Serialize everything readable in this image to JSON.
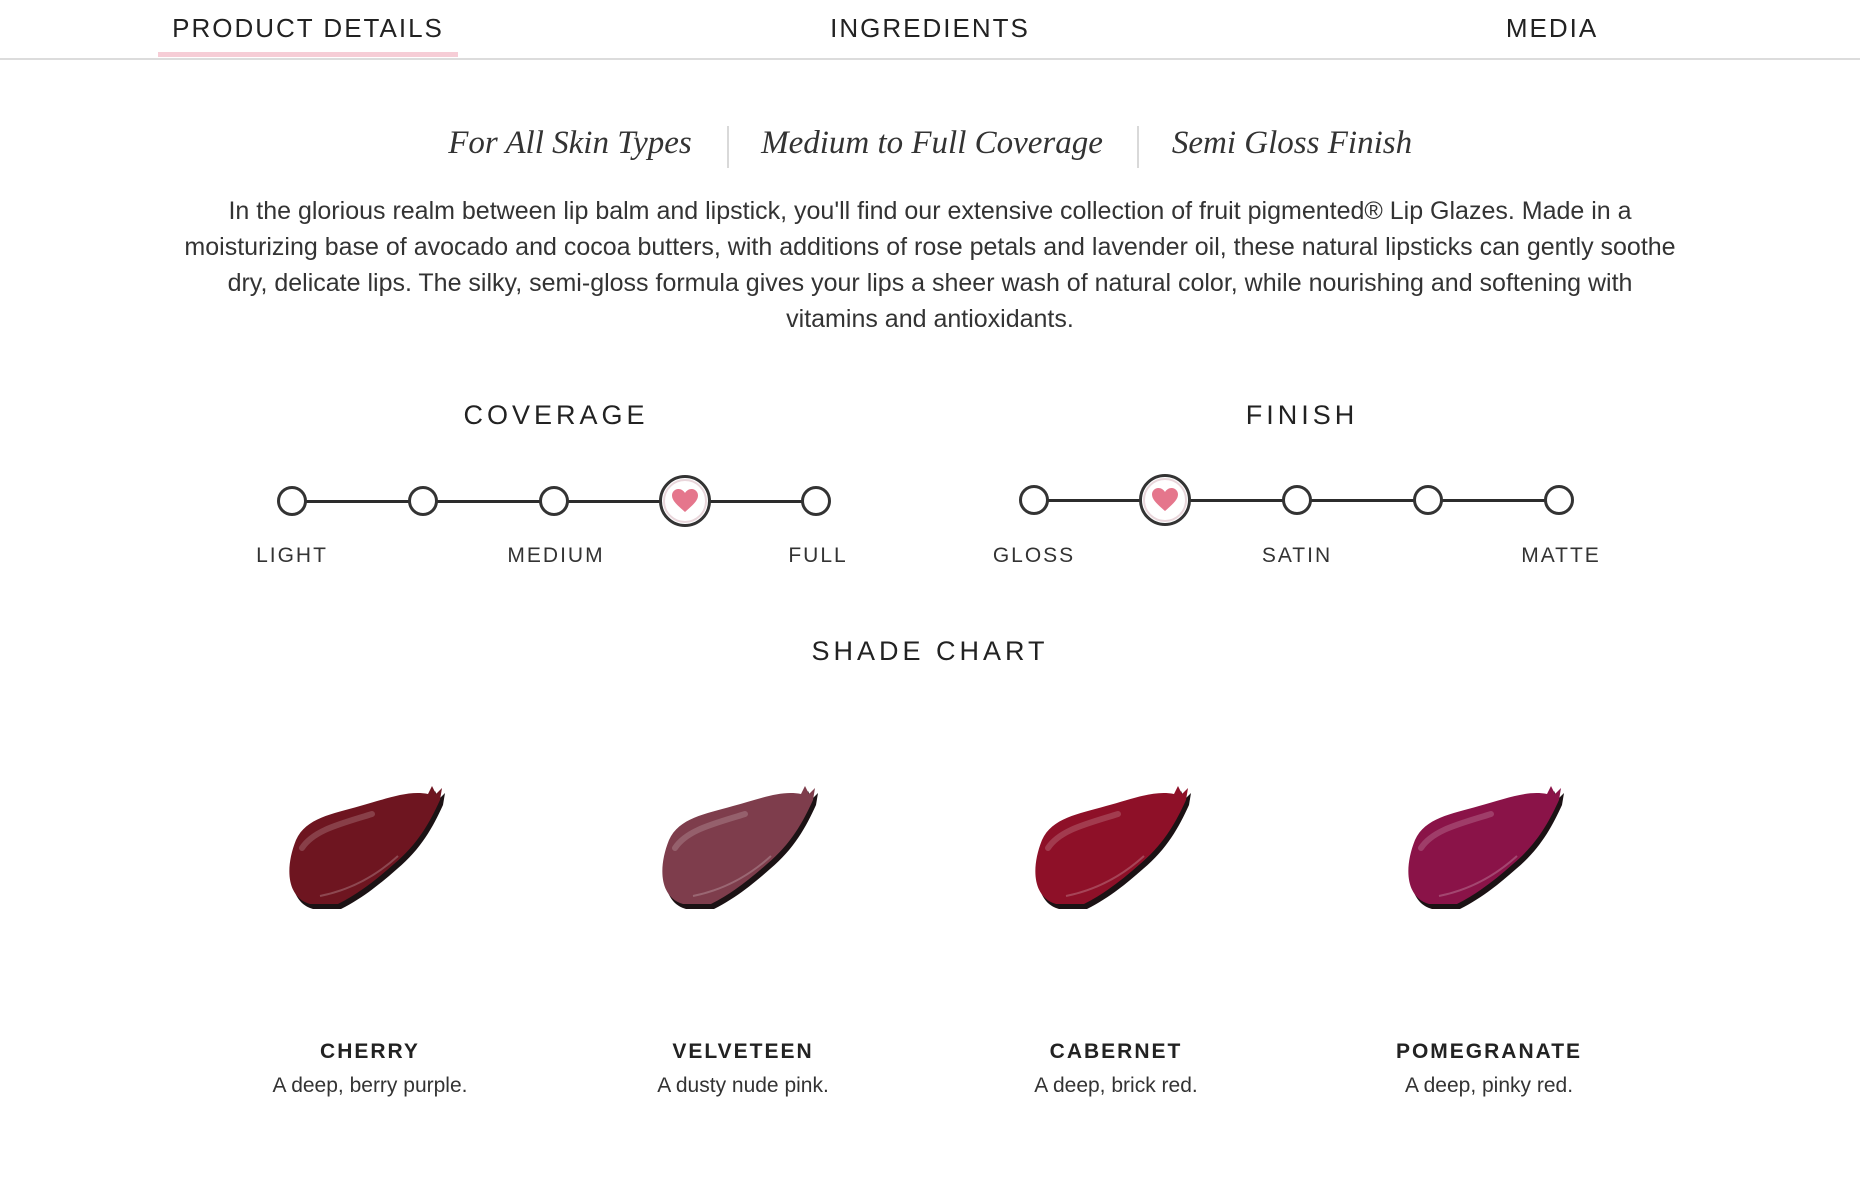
{
  "tabs": [
    {
      "label": "PRODUCT DETAILS",
      "active": true
    },
    {
      "label": "INGREDIENTS",
      "active": false
    },
    {
      "label": "MEDIA",
      "active": false
    }
  ],
  "taglines": [
    "For All Skin Types",
    "Medium to Full Coverage",
    "Semi Gloss Finish"
  ],
  "description": "In the glorious realm between lip balm and lipstick, you'll find our extensive collection of fruit pigmented® Lip Glazes. Made in a moisturizing base of avocado and cocoa butters, with additions of rose petals and lavender oil, these natural lipsticks can gently soothe dry, delicate lips. The silky, semi-gloss formula gives your lips a sheer wash of natural color, while nourishing and softening with vitamins and antioxidants.",
  "coverage": {
    "heading": "COVERAGE",
    "steps": 5,
    "selected_index": 3,
    "labels": [
      "LIGHT",
      "MEDIUM",
      "FULL"
    ]
  },
  "finish": {
    "heading": "FINISH",
    "steps": 5,
    "selected_index": 1,
    "labels": [
      "GLOSS",
      "SATIN",
      "MATTE"
    ]
  },
  "heart_color": "#e5768c",
  "shade_chart": {
    "heading": "SHADE CHART",
    "shades": [
      {
        "name": "CHERRY",
        "description": "A deep, berry purple.",
        "color": "#6e1520"
      },
      {
        "name": "VELVETEEN",
        "description": "A dusty nude pink.",
        "color": "#7e3d4c"
      },
      {
        "name": "CABERNET",
        "description": "A deep, brick red.",
        "color": "#8e1028"
      },
      {
        "name": "POMEGRANATE",
        "description": "A deep, pinky red.",
        "color": "#8a1348"
      }
    ]
  }
}
